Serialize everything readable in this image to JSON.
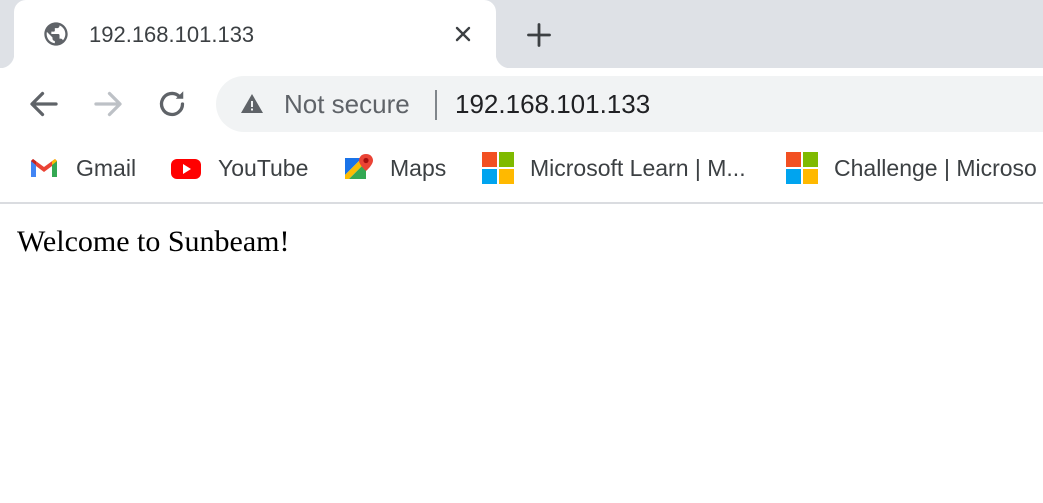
{
  "tab": {
    "title": "192.168.101.133",
    "favicon": "globe-icon",
    "close_icon": "close-icon"
  },
  "new_tab_icon": "plus-icon",
  "toolbar": {
    "back_icon": "back-arrow-icon",
    "forward_icon": "forward-arrow-icon",
    "reload_icon": "reload-icon"
  },
  "omnibox": {
    "security_icon": "warning-triangle-icon",
    "security_label": "Not secure",
    "url": "192.168.101.133"
  },
  "bookmarks": [
    {
      "label": "Gmail",
      "icon": "gmail-icon"
    },
    {
      "label": "YouTube",
      "icon": "youtube-icon"
    },
    {
      "label": "Maps",
      "icon": "maps-icon"
    },
    {
      "label": "Microsoft Learn | M...",
      "icon": "microsoft-icon"
    },
    {
      "label": "Challenge | Microso",
      "icon": "microsoft-icon"
    }
  ],
  "page": {
    "welcome_text": "Welcome to Sunbeam!"
  },
  "colors": {
    "tabstrip_bg": "#dee1e6",
    "omnibox_bg": "#f1f3f4",
    "text_primary": "#202124",
    "text_muted": "#5f6368"
  }
}
